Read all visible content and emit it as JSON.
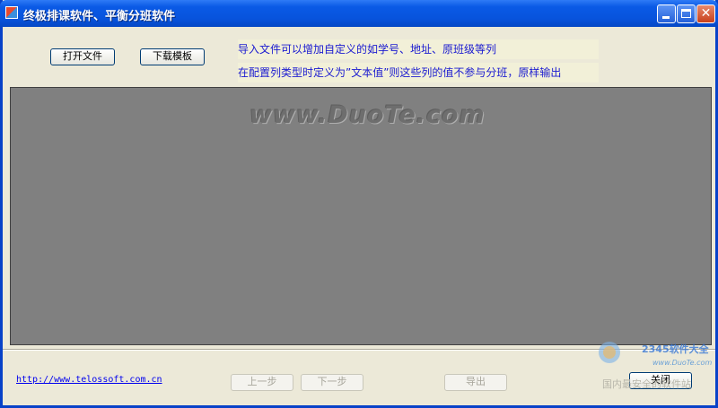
{
  "window": {
    "title": "终极排课软件、平衡分班软件",
    "minimize_label": "minimize",
    "maximize_label": "maximize",
    "close_label": "close"
  },
  "toolbar": {
    "open_file": "打开文件",
    "download_template": "下载模板"
  },
  "info": {
    "line1": "导入文件可以增加自定义的如学号、地址、原班级等列",
    "line2": "在配置列类型时定义为”文本值”则这些列的值不参与分班，原样输出"
  },
  "watermark": "www.DuoTe.com",
  "footer": {
    "website": "http://www.telossoft.com.cn",
    "prev": "上一步",
    "next": "下一步",
    "export": "导出",
    "close": "关闭"
  },
  "corner_badge": {
    "brand": "2345软件大全",
    "url": "www.DuoTe.com",
    "tagline": "国内最安全的软件站"
  },
  "colors": {
    "titlebar": "#0a5ae6",
    "grid_background": "#808080",
    "info_text": "#1b1bd0",
    "link": "#0000ee"
  }
}
